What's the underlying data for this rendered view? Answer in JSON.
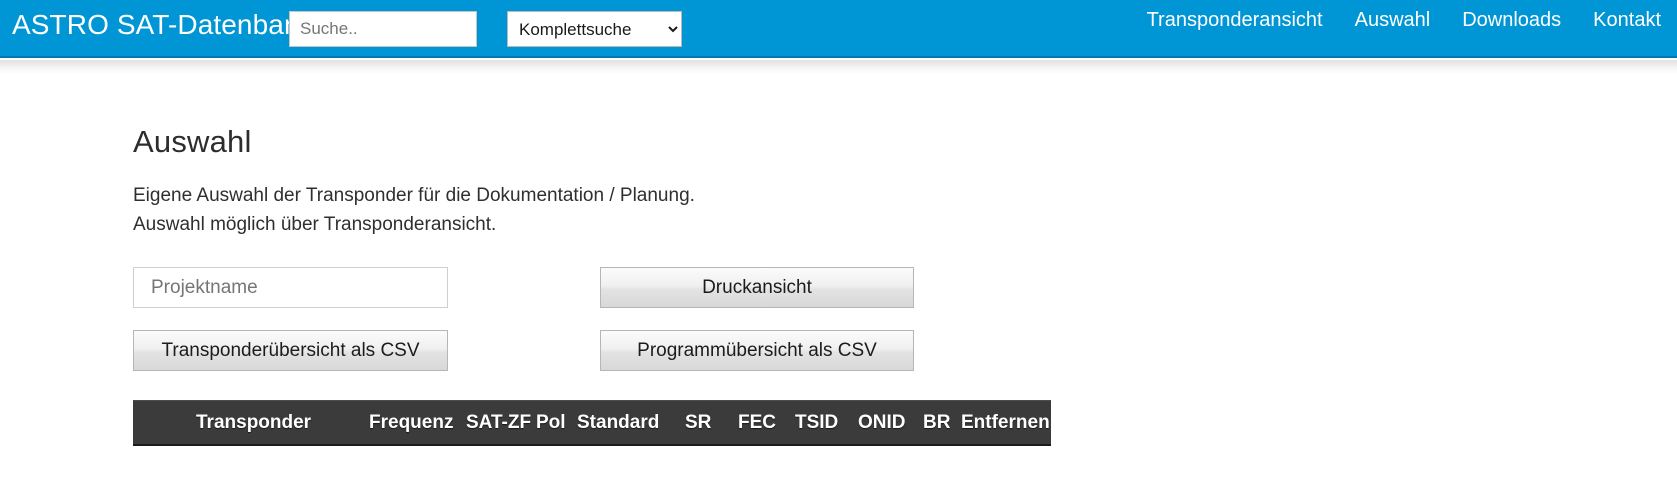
{
  "header": {
    "brand": "ASTRO SAT-Datenbank",
    "search": {
      "placeholder": "Suche..",
      "value": ""
    },
    "scope_select": {
      "selected": "Komplettsuche",
      "options": [
        "Komplettsuche"
      ]
    },
    "nav": [
      {
        "label": "Transponderansicht"
      },
      {
        "label": "Auswahl"
      },
      {
        "label": "Downloads"
      },
      {
        "label": "Kontakt"
      }
    ],
    "colors": {
      "bar_background": "#0095d5",
      "bar_border": "#0079ae",
      "link_text": "#ffffff"
    }
  },
  "main": {
    "title": "Auswahl",
    "intro_line1": "Eigene Auswahl der Transponder für die Dokumentation / Planung.",
    "intro_line2": "Auswahl möglich über Transponderansicht.",
    "project_input": {
      "placeholder": "Projektname",
      "value": ""
    },
    "buttons": {
      "print_view": "Druckansicht",
      "transponder_csv": "Transponderübersicht als CSV",
      "program_csv": "Programmübersicht als CSV"
    },
    "table": {
      "columns": [
        "Transponder",
        "Frequenz",
        "SAT-ZF",
        "Pol",
        "Standard",
        "SR",
        "FEC",
        "TSID",
        "ONID",
        "BR",
        "Entfernen"
      ],
      "rows": [],
      "header_background": "#3b3b3b",
      "header_text_color": "#ffffff"
    }
  }
}
